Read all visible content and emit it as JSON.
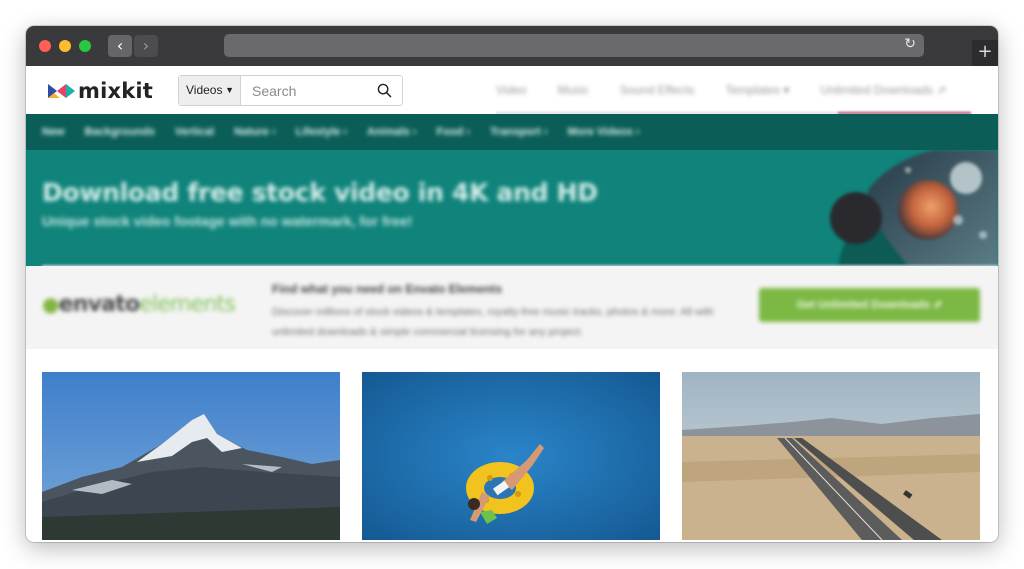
{
  "browser": {
    "back_icon": "chevron-left-icon",
    "forward_icon": "chevron-right-icon",
    "reload_icon": "reload-icon",
    "new_tab_icon": "plus-icon"
  },
  "header": {
    "logo_text": "mixkit",
    "search": {
      "category": "Videos",
      "placeholder": "Search"
    },
    "nav": [
      "Video",
      "Music",
      "Sound Effects",
      "Templates ▾",
      "Unlimited Downloads ⇗"
    ]
  },
  "categories": [
    "New",
    "Backgrounds",
    "Vertical",
    "Nature ›",
    "Lifestyle ›",
    "Animals ›",
    "Food ›",
    "Transport ›",
    "More Videos ›"
  ],
  "hero": {
    "title": "Download free stock video in 4K and HD",
    "subtitle": "Unique stock video footage with no watermark, for free!"
  },
  "envato": {
    "logo_part1": "envato",
    "logo_part2": "elements",
    "heading": "Find what you need on Envato Elements",
    "description": "Discover millions of stock videos & templates, royalty-free music tracks, photos & more. All with unlimited downloads & simple commercial licensing for any project.",
    "button": "Get Unlimited Downloads ⇗"
  },
  "colors": {
    "category_bar": "#0b5e58",
    "hero_bg": "#10847b",
    "envato_green": "#7cb844"
  }
}
